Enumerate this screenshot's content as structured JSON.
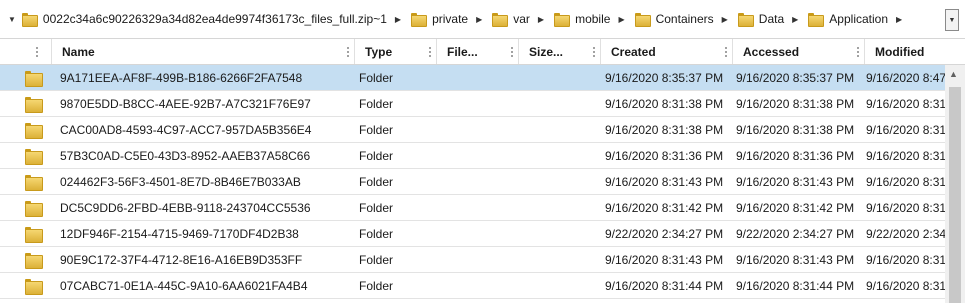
{
  "breadcrumb": {
    "items": [
      {
        "label": "0022c34a6c90226329a34d82ea4de9974f36173c_files_full.zip~1"
      },
      {
        "label": "private"
      },
      {
        "label": "var"
      },
      {
        "label": "mobile"
      },
      {
        "label": "Containers"
      },
      {
        "label": "Data"
      },
      {
        "label": "Application"
      }
    ]
  },
  "columns": {
    "name": "Name",
    "type": "Type",
    "file": "File...",
    "size": "Size...",
    "created": "Created",
    "accessed": "Accessed",
    "modified": "Modified"
  },
  "rows": [
    {
      "name": "9A171EEA-AF8F-499B-B186-6266F2FA7548",
      "type": "Folder",
      "created": "9/16/2020 8:35:37 PM",
      "accessed": "9/16/2020 8:35:37 PM",
      "modified": "9/16/2020 8:47"
    },
    {
      "name": "9870E5DD-B8CC-4AEE-92B7-A7C321F76E97",
      "type": "Folder",
      "created": "9/16/2020 8:31:38 PM",
      "accessed": "9/16/2020 8:31:38 PM",
      "modified": "9/16/2020 8:31"
    },
    {
      "name": "CAC00AD8-4593-4C97-ACC7-957DA5B356E4",
      "type": "Folder",
      "created": "9/16/2020 8:31:38 PM",
      "accessed": "9/16/2020 8:31:38 PM",
      "modified": "9/16/2020 8:31"
    },
    {
      "name": "57B3C0AD-C5E0-43D3-8952-AAEB37A58C66",
      "type": "Folder",
      "created": "9/16/2020 8:31:36 PM",
      "accessed": "9/16/2020 8:31:36 PM",
      "modified": "9/16/2020 8:31"
    },
    {
      "name": "024462F3-56F3-4501-8E7D-8B46E7B033AB",
      "type": "Folder",
      "created": "9/16/2020 8:31:43 PM",
      "accessed": "9/16/2020 8:31:43 PM",
      "modified": "9/16/2020 8:31"
    },
    {
      "name": "DC5C9DD6-2FBD-4EBB-9118-243704CC5536",
      "type": "Folder",
      "created": "9/16/2020 8:31:42 PM",
      "accessed": "9/16/2020 8:31:42 PM",
      "modified": "9/16/2020 8:31"
    },
    {
      "name": "12DF946F-2154-4715-9469-7170DF4D2B38",
      "type": "Folder",
      "created": "9/22/2020 2:34:27 PM",
      "accessed": "9/22/2020 2:34:27 PM",
      "modified": "9/22/2020 2:34"
    },
    {
      "name": "90E9C172-37F4-4712-8E16-A16EB9D353FF",
      "type": "Folder",
      "created": "9/16/2020 8:31:43 PM",
      "accessed": "9/16/2020 8:31:43 PM",
      "modified": "9/16/2020 8:31"
    },
    {
      "name": "07CABC71-0E1A-445C-9A10-6AA6021FA4B4",
      "type": "Folder",
      "created": "9/16/2020 8:31:44 PM",
      "accessed": "9/16/2020 8:31:44 PM",
      "modified": "9/16/2020 8:31"
    }
  ],
  "colors": {
    "selected_row": "#c5def2",
    "folder": "#f0cc5a"
  },
  "icons": {
    "folder": "folder-icon",
    "separator": "chevron-right-icon",
    "expand": "chevron-down-icon"
  }
}
